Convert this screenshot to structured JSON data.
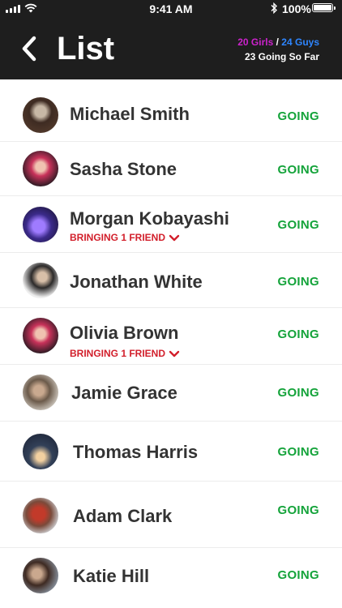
{
  "status_bar": {
    "time": "9:41 AM",
    "battery": "100%",
    "battery_level": 1.0
  },
  "header": {
    "title": "List",
    "girls": "20 Girls",
    "separator": " / ",
    "guys": "24 Guys",
    "going_so_far": "23 Going So Far"
  },
  "colors": {
    "girls": "#cc22cc",
    "guys": "#2e86ff",
    "going": "#14a33a",
    "friend": "#d21f2b",
    "header_bg": "#1e1e1e"
  },
  "people": [
    {
      "name": "Michael Smith",
      "status": "GOING"
    },
    {
      "name": "Sasha Stone",
      "status": "GOING"
    },
    {
      "name": "Morgan Kobayashi",
      "status": "GOING",
      "note": "BRINGING 1 FRIEND"
    },
    {
      "name": "Jonathan White",
      "status": "GOING"
    },
    {
      "name": "Olivia Brown",
      "status": "GOING",
      "note": "BRINGING 1 FRIEND"
    },
    {
      "name": "Jamie Grace",
      "status": "GOING"
    },
    {
      "name": "Thomas Harris",
      "status": "GOING"
    },
    {
      "name": "Adam Clark",
      "status": "GOING"
    },
    {
      "name": "Katie Hill",
      "status": "GOING"
    }
  ]
}
